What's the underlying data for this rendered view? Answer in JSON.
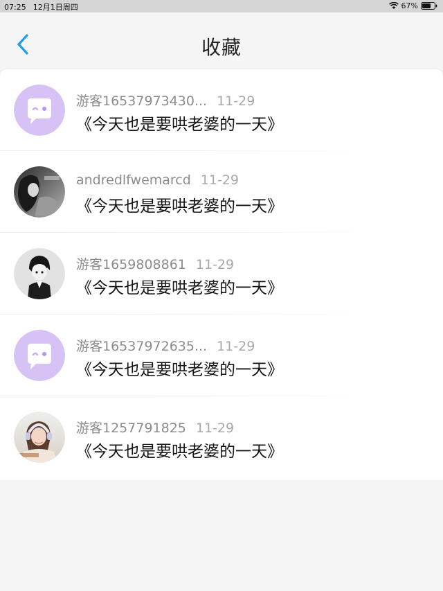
{
  "status_bar": {
    "time": "07:25",
    "date": "12月1日周四",
    "battery": "67%"
  },
  "header": {
    "title": "收藏"
  },
  "colors": {
    "accent": "#1f9cf0",
    "placeholder_avatar": "#d7c2f5"
  },
  "favorites": [
    {
      "user": "游客16537973430...",
      "date": "11-29",
      "title": "《今天也是要哄老婆的一天》",
      "avatar": "default-chat-avatar"
    },
    {
      "user": "andredlfwemarcd",
      "date": "11-29",
      "title": "《今天也是要哄老婆的一天》",
      "avatar": "photo-girl-grayscale"
    },
    {
      "user": "游客1659808861",
      "date": "11-29",
      "title": "《今天也是要哄老婆的一天》",
      "avatar": "anime-boy"
    },
    {
      "user": "游客16537972635...",
      "date": "11-29",
      "title": "《今天也是要哄老婆的一天》",
      "avatar": "default-chat-avatar"
    },
    {
      "user": "游客1257791825",
      "date": "11-29",
      "title": "《今天也是要哄老婆的一天》",
      "avatar": "photo-girl-headphones"
    }
  ]
}
